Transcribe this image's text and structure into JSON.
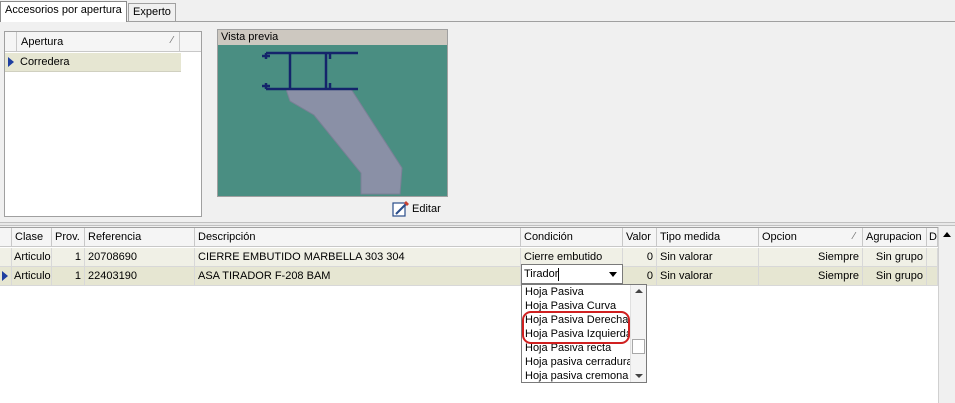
{
  "tabs": [
    {
      "label": "Accesorios por apertura",
      "active": true
    },
    {
      "label": "Experto",
      "active": false
    }
  ],
  "apertura": {
    "header": "Apertura",
    "rows": [
      "Corredera"
    ]
  },
  "preview": {
    "title": "Vista previa",
    "edit_label": "Editar"
  },
  "grid": {
    "columns": [
      "Clase",
      "Prov.",
      "Referencia",
      "Descripción",
      "Condición",
      "Valor",
      "Tipo medida",
      "Opcion",
      "Agrupacion",
      "D"
    ],
    "rows": [
      {
        "clase": "Articulo",
        "prov": "1",
        "referencia": "20708690",
        "descripcion": "CIERRE EMBUTIDO MARBELLA 303 304",
        "condicion": "Cierre embutido",
        "valor": "0",
        "tipo_medida": "Sin valorar",
        "opcion": "Siempre",
        "agrupacion": "Sin grupo"
      },
      {
        "clase": "Articulo",
        "prov": "1",
        "referencia": "22403190",
        "descripcion": "ASA TIRADOR F-208 BAM",
        "condicion": "Tirador",
        "valor": "0",
        "tipo_medida": "Sin valorar",
        "opcion": "Siempre",
        "agrupacion": "Sin grupo"
      }
    ]
  },
  "dropdown": {
    "items": [
      "Hoja Pasiva",
      "Hoja Pasiva Curva",
      "Hoja Pasiva Derecha",
      "Hoja Pasiva Izquierda",
      "Hoja Pasiva recta",
      "Hoja pasiva cerradura",
      "Hoja pasiva cremona"
    ]
  },
  "colors": {
    "selected_row": "#e6e6d2",
    "preview_bg": "#4a8e82",
    "highlight": "#d02020",
    "row_marker": "#1f3fa0"
  }
}
